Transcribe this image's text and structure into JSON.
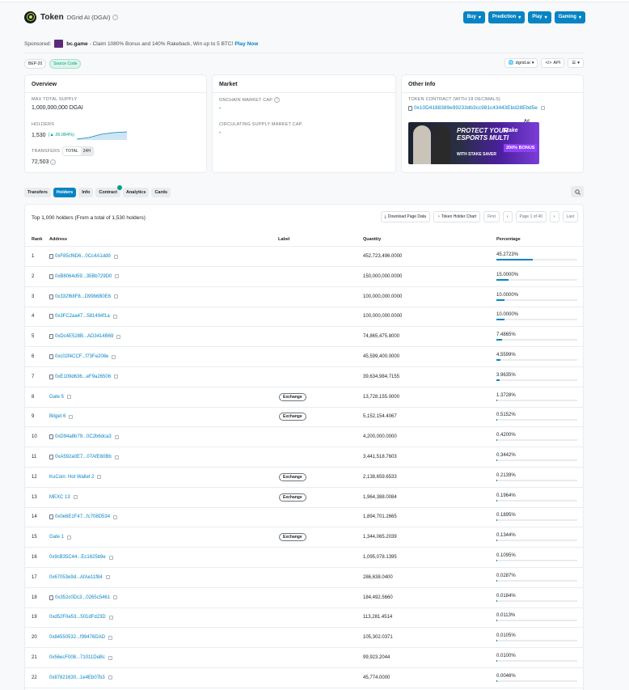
{
  "header": {
    "title": "Token",
    "token_name": "DGrid AI (DGAI)",
    "buttons": [
      "Buy",
      "Prediction",
      "Play",
      "Gaming"
    ]
  },
  "sponsored": {
    "label": "Sponsored:",
    "name": "bc.game",
    "text": "- Claim 1080% Bonus and 140% Rakeback, Win up to 5 BTC!",
    "link": "Play Now"
  },
  "badges": [
    "BEP-20",
    "Source Code"
  ],
  "tools": [
    "dgrid.ai",
    "API"
  ],
  "overview": {
    "title": "Overview",
    "max_supply_label": "MAX TOTAL SUPPLY",
    "max_supply": "1,000,000,000 DGAI",
    "holders_label": "HOLDERS",
    "holders": "1,530",
    "holders_change": "(▲ 26.084%)",
    "transfers_label": "TRANSFERS",
    "toggle_total": "TOTAL",
    "toggle_24h": "24H",
    "transfers": "72,503"
  },
  "market": {
    "title": "Market",
    "onchain_label": "ONCHAIN MARKET CAP",
    "onchain_value": "-",
    "circ_label": "CIRCULATING SUPPLY MARKET CAP",
    "circ_value": "-"
  },
  "other": {
    "title": "Other Info",
    "contract_label": "TOKEN CONTRACT (WITH 18 DECIMALS)",
    "contract": "0x10D4188389e99233db3cc981c43443Ebd28Ebd5e",
    "ad_tag": "Ad",
    "ad_line1": "PROTECT YOUR",
    "ad_line2": "ESPORTS MULTI",
    "ad_line3": "WITH STAKE SAVER",
    "ad_brand": "Stake",
    "ad_bonus": "200% BONUS"
  },
  "tabs": [
    "Transfers",
    "Holders",
    "Info",
    "Contract",
    "Analytics",
    "Cards"
  ],
  "table": {
    "summary": "Top 1,000 holders (From a total of 1,530 holders)",
    "download": "Download Page Data",
    "chart": "Token Holder Chart",
    "first": "First",
    "page": "Page 1 of 40",
    "last": "Last",
    "headers": [
      "Rank",
      "Address",
      "Label",
      "Quantity",
      "Percentage"
    ],
    "rows": [
      {
        "rank": "1",
        "address": "0xF85cf6D6...0Cc4A1dd9",
        "label": "",
        "qty": "452,723,496.0000",
        "pct": "45.2723%",
        "fill": 0.452723,
        "contract": true
      },
      {
        "rank": "2",
        "address": "0xB8064d59...35Bb729D0",
        "label": "",
        "qty": "150,000,000.0000",
        "pct": "15.0000%",
        "fill": 0.15,
        "contract": true
      },
      {
        "rank": "3",
        "address": "0x332f68F8...D99b6B0E6",
        "label": "",
        "qty": "100,000,000.0000",
        "pct": "10.0000%",
        "fill": 0.1,
        "contract": true
      },
      {
        "rank": "4",
        "address": "0x3FC2aa47...581494f1a",
        "label": "",
        "qty": "100,000,000.0000",
        "pct": "10.0000%",
        "fill": 0.1,
        "contract": true
      },
      {
        "rank": "5",
        "address": "0xDc4E528B...AD3414B69",
        "label": "",
        "qty": "74,865,475.8000",
        "pct": "7.4865%",
        "fill": 0.074865,
        "contract": true
      },
      {
        "rank": "6",
        "address": "0xc02f4CCF...f73Fe208e",
        "label": "",
        "qty": "45,599,400.0000",
        "pct": "4.5599%",
        "fill": 0.045599,
        "contract": true
      },
      {
        "rank": "7",
        "address": "0xE109d636...eF9a26506",
        "label": "",
        "qty": "39,634,984.7155",
        "pct": "3.9635%",
        "fill": 0.039635,
        "contract": true
      },
      {
        "rank": "8",
        "address": "Gate 5",
        "label": "Exchange",
        "qty": "13,728,155.0000",
        "pct": "1.3728%",
        "fill": 0.013728,
        "contract": false
      },
      {
        "rank": "9",
        "address": "Bitget 6",
        "label": "Exchange",
        "qty": "5,152,154.4067",
        "pct": "0.5152%",
        "fill": 0.005152,
        "contract": false
      },
      {
        "rank": "10",
        "address": "0xD94a8b79...0C2b6dca3",
        "label": "",
        "qty": "4,200,000.0000",
        "pct": "0.4200%",
        "fill": 0.0042,
        "contract": true
      },
      {
        "rank": "11",
        "address": "0xA592a0E7...07AfE60Bb",
        "label": "",
        "qty": "3,441,518.7603",
        "pct": "0.3442%",
        "fill": 0.003442,
        "contract": true
      },
      {
        "rank": "12",
        "address": "KuCoin: Hot Wallet 2",
        "label": "Exchange",
        "qty": "2,138,659.6533",
        "pct": "0.2139%",
        "fill": 0.002139,
        "contract": false
      },
      {
        "rank": "13",
        "address": "MEXC 13",
        "label": "Exchange",
        "qty": "1,964,388.0084",
        "pct": "0.1964%",
        "fill": 0.001964,
        "contract": false
      },
      {
        "rank": "14",
        "address": "0x0e6E1F47...fc708D534",
        "label": "",
        "qty": "1,894,701.2665",
        "pct": "0.1895%",
        "fill": 0.001895,
        "contract": true
      },
      {
        "rank": "15",
        "address": "Gate 1",
        "label": "Exchange",
        "qty": "1,344,065.2039",
        "pct": "0.1344%",
        "fill": 0.001344,
        "contract": false
      },
      {
        "rank": "16",
        "address": "0x9cB35C44...Ec1625b9e",
        "label": "",
        "qty": "1,095,078.1395",
        "pct": "0.1095%",
        "fill": 0.001095,
        "contract": false
      },
      {
        "rank": "17",
        "address": "0x67053e9d...AfAe11f84",
        "label": "",
        "qty": "286,638.0400",
        "pct": "0.0287%",
        "fill": 0.000287,
        "contract": false
      },
      {
        "rank": "18",
        "address": "0x352c0Dc3...0265c5461",
        "label": "",
        "qty": "184,492.5660",
        "pct": "0.0184%",
        "fill": 0.000184,
        "contract": true
      },
      {
        "rank": "19",
        "address": "0xd52F0e53...501dFd23D",
        "label": "",
        "qty": "113,281.4514",
        "pct": "0.0113%",
        "fill": 0.000113,
        "contract": false
      },
      {
        "rank": "20",
        "address": "0x84550532...f99476DAD",
        "label": "",
        "qty": "105,302.0371",
        "pct": "0.0105%",
        "fill": 0.000105,
        "contract": false
      },
      {
        "rank": "21",
        "address": "0x56ecF008...71011DeBc",
        "label": "",
        "qty": "99,923.2044",
        "pct": "0.0100%",
        "fill": 0.0001,
        "contract": false
      },
      {
        "rank": "22",
        "address": "0x87821630...1e4Eb07b3",
        "label": "",
        "qty": "45,774.0000",
        "pct": "0.0046%",
        "fill": 4.6e-05,
        "contract": false
      }
    ]
  },
  "colors": {
    "accent": "#0784c3",
    "green": "#00a186"
  }
}
